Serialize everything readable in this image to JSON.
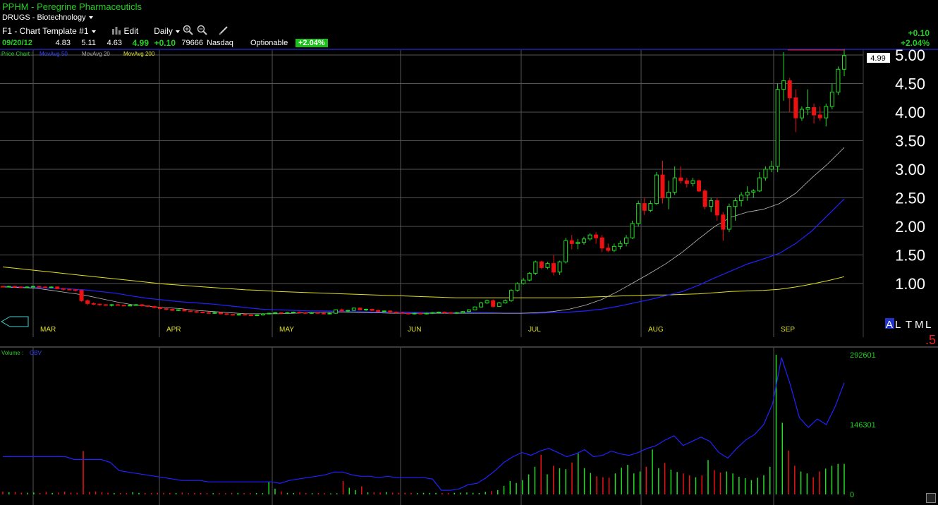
{
  "header": {
    "title": "PPHM - Peregrine Pharmaceuticls",
    "sector": "DRUGS - Biotechnology",
    "template": "F1 - Chart Template #1",
    "edit_label": "Edit",
    "period": "Daily",
    "icons": [
      "bar-chart-icon",
      "zoom-in-icon",
      "zoom-out-icon",
      "draw-pen-icon"
    ]
  },
  "quote": {
    "date": "09/20/12",
    "open": "4.83",
    "high": "5.11",
    "low": "4.63",
    "last": "4.99",
    "change": "+0.10",
    "volume": "79666",
    "exchange": "Nasdaq",
    "optionable": "Optionable",
    "change_pct": "+2.04%"
  },
  "top_change": {
    "value": "+0.10",
    "pct": "+2.04%"
  },
  "price_legend": {
    "label": "Price Chart :",
    "ma50": "MovAvg 50",
    "ma20": "MovAvg 20",
    "ma200": "MovAvg 200"
  },
  "volume_legend": {
    "label": "Volume :",
    "obv": "OBV"
  },
  "current_price_label": "4.99",
  "range_buttons": {
    "a": "A",
    "l": "L",
    "t": "T",
    "m": "M",
    "l2": "L"
  },
  "scale_note": ".5",
  "colors": {
    "up": "#22dd22",
    "down": "#ee1111",
    "ma20": "#cccccc",
    "ma50": "#2222ff",
    "ma200": "#e0e020",
    "obv": "#2222ff",
    "grid": "#555555"
  },
  "chart_data": [
    {
      "type": "candlestick",
      "y_ticks": [
        "5.00",
        "4.50",
        "4.00",
        "3.50",
        "3.00",
        "2.50",
        "2.00",
        "1.50",
        "1.00"
      ],
      "months": [
        "MAR",
        "APR",
        "MAY",
        "JUN",
        "JUL",
        "AUG",
        "SEP"
      ],
      "ylim": [
        0.2,
        5.05
      ],
      "candles": [
        [
          0.95,
          0.96,
          0.93,
          0.94
        ],
        [
          0.94,
          0.96,
          0.93,
          0.95
        ],
        [
          0.95,
          0.96,
          0.93,
          0.94
        ],
        [
          0.94,
          0.95,
          0.92,
          0.93
        ],
        [
          0.93,
          0.95,
          0.92,
          0.94
        ],
        [
          0.94,
          0.96,
          0.93,
          0.95
        ],
        [
          0.95,
          0.96,
          0.93,
          0.94
        ],
        [
          0.94,
          0.95,
          0.92,
          0.93
        ],
        [
          0.93,
          0.95,
          0.92,
          0.94
        ],
        [
          0.94,
          0.95,
          0.9,
          0.91
        ],
        [
          0.91,
          0.92,
          0.88,
          0.9
        ],
        [
          0.9,
          0.91,
          0.88,
          0.89
        ],
        [
          0.89,
          0.9,
          0.86,
          0.88
        ],
        [
          0.88,
          0.89,
          0.68,
          0.7
        ],
        [
          0.7,
          0.72,
          0.62,
          0.65
        ],
        [
          0.65,
          0.67,
          0.62,
          0.64
        ],
        [
          0.64,
          0.65,
          0.61,
          0.63
        ],
        [
          0.63,
          0.64,
          0.61,
          0.62
        ],
        [
          0.62,
          0.64,
          0.6,
          0.63
        ],
        [
          0.63,
          0.64,
          0.61,
          0.62
        ],
        [
          0.62,
          0.63,
          0.6,
          0.61
        ],
        [
          0.61,
          0.63,
          0.6,
          0.62
        ],
        [
          0.62,
          0.64,
          0.61,
          0.63
        ],
        [
          0.63,
          0.64,
          0.6,
          0.61
        ],
        [
          0.61,
          0.62,
          0.59,
          0.6
        ],
        [
          0.6,
          0.61,
          0.57,
          0.58
        ],
        [
          0.58,
          0.59,
          0.55,
          0.56
        ],
        [
          0.56,
          0.57,
          0.53,
          0.55
        ],
        [
          0.55,
          0.56,
          0.52,
          0.53
        ],
        [
          0.53,
          0.55,
          0.52,
          0.54
        ],
        [
          0.54,
          0.55,
          0.51,
          0.52
        ],
        [
          0.52,
          0.53,
          0.5,
          0.51
        ],
        [
          0.51,
          0.52,
          0.49,
          0.5
        ],
        [
          0.5,
          0.51,
          0.48,
          0.49
        ],
        [
          0.49,
          0.5,
          0.47,
          0.48
        ],
        [
          0.48,
          0.5,
          0.47,
          0.49
        ],
        [
          0.49,
          0.5,
          0.46,
          0.47
        ],
        [
          0.47,
          0.48,
          0.45,
          0.46
        ],
        [
          0.46,
          0.47,
          0.44,
          0.45
        ],
        [
          0.45,
          0.47,
          0.44,
          0.46
        ],
        [
          0.46,
          0.47,
          0.44,
          0.45
        ],
        [
          0.45,
          0.46,
          0.43,
          0.44
        ],
        [
          0.44,
          0.46,
          0.43,
          0.45
        ],
        [
          0.45,
          0.48,
          0.44,
          0.47
        ],
        [
          0.47,
          0.49,
          0.46,
          0.48
        ],
        [
          0.48,
          0.5,
          0.47,
          0.49
        ],
        [
          0.49,
          0.5,
          0.47,
          0.48
        ],
        [
          0.48,
          0.5,
          0.47,
          0.49
        ],
        [
          0.49,
          0.51,
          0.48,
          0.5
        ],
        [
          0.5,
          0.51,
          0.48,
          0.49
        ],
        [
          0.49,
          0.5,
          0.47,
          0.48
        ],
        [
          0.48,
          0.5,
          0.47,
          0.49
        ],
        [
          0.49,
          0.5,
          0.47,
          0.48
        ],
        [
          0.48,
          0.49,
          0.46,
          0.47
        ],
        [
          0.47,
          0.49,
          0.46,
          0.48
        ],
        [
          0.48,
          0.55,
          0.47,
          0.54
        ],
        [
          0.54,
          0.56,
          0.51,
          0.52
        ],
        [
          0.52,
          0.54,
          0.5,
          0.53
        ],
        [
          0.53,
          0.58,
          0.52,
          0.57
        ],
        [
          0.57,
          0.58,
          0.53,
          0.54
        ],
        [
          0.54,
          0.56,
          0.52,
          0.55
        ],
        [
          0.55,
          0.56,
          0.52,
          0.53
        ],
        [
          0.53,
          0.54,
          0.5,
          0.51
        ],
        [
          0.51,
          0.53,
          0.5,
          0.52
        ],
        [
          0.52,
          0.53,
          0.49,
          0.5
        ],
        [
          0.5,
          0.51,
          0.48,
          0.49
        ],
        [
          0.49,
          0.5,
          0.47,
          0.48
        ],
        [
          0.48,
          0.49,
          0.46,
          0.47
        ],
        [
          0.47,
          0.49,
          0.46,
          0.48
        ],
        [
          0.48,
          0.49,
          0.46,
          0.47
        ],
        [
          0.47,
          0.49,
          0.46,
          0.48
        ],
        [
          0.48,
          0.5,
          0.47,
          0.49
        ],
        [
          0.49,
          0.51,
          0.48,
          0.5
        ],
        [
          0.5,
          0.51,
          0.48,
          0.49
        ],
        [
          0.49,
          0.5,
          0.47,
          0.48
        ],
        [
          0.48,
          0.5,
          0.47,
          0.49
        ],
        [
          0.49,
          0.52,
          0.48,
          0.51
        ],
        [
          0.51,
          0.55,
          0.5,
          0.54
        ],
        [
          0.54,
          0.6,
          0.53,
          0.59
        ],
        [
          0.59,
          0.68,
          0.58,
          0.66
        ],
        [
          0.66,
          0.72,
          0.64,
          0.7
        ],
        [
          0.7,
          0.72,
          0.58,
          0.6
        ],
        [
          0.6,
          0.68,
          0.59,
          0.66
        ],
        [
          0.66,
          0.72,
          0.65,
          0.7
        ],
        [
          0.7,
          0.9,
          0.68,
          0.88
        ],
        [
          0.88,
          1.02,
          0.86,
          1.0
        ],
        [
          1.0,
          1.1,
          0.98,
          1.06
        ],
        [
          1.06,
          1.2,
          1.04,
          1.18
        ],
        [
          1.18,
          1.4,
          1.15,
          1.38
        ],
        [
          1.38,
          1.4,
          1.25,
          1.28
        ],
        [
          1.28,
          1.38,
          1.25,
          1.35
        ],
        [
          1.35,
          1.5,
          1.14,
          1.2
        ],
        [
          1.2,
          1.4,
          1.15,
          1.38
        ],
        [
          1.38,
          1.8,
          1.35,
          1.75
        ],
        [
          1.75,
          1.85,
          1.6,
          1.7
        ],
        [
          1.7,
          1.78,
          1.6,
          1.72
        ],
        [
          1.72,
          1.82,
          1.68,
          1.78
        ],
        [
          1.78,
          1.88,
          1.75,
          1.85
        ],
        [
          1.85,
          1.9,
          1.7,
          1.8
        ],
        [
          1.8,
          1.85,
          1.55,
          1.62
        ],
        [
          1.62,
          1.7,
          1.55,
          1.58
        ],
        [
          1.58,
          1.7,
          1.55,
          1.65
        ],
        [
          1.65,
          1.75,
          1.6,
          1.7
        ],
        [
          1.7,
          1.85,
          1.65,
          1.8
        ],
        [
          1.8,
          2.1,
          1.78,
          2.05
        ],
        [
          2.05,
          2.45,
          2.0,
          2.4
        ],
        [
          2.4,
          2.5,
          2.2,
          2.28
        ],
        [
          2.28,
          2.45,
          2.25,
          2.4
        ],
        [
          2.4,
          2.95,
          2.38,
          2.9
        ],
        [
          2.9,
          3.15,
          2.4,
          2.5
        ],
        [
          2.5,
          2.8,
          2.3,
          2.6
        ],
        [
          2.6,
          3.05,
          2.55,
          2.85
        ],
        [
          2.85,
          3.05,
          2.75,
          2.8
        ],
        [
          2.8,
          2.85,
          2.68,
          2.75
        ],
        [
          2.75,
          2.85,
          2.7,
          2.8
        ],
        [
          2.8,
          2.82,
          2.6,
          2.62
        ],
        [
          2.62,
          2.65,
          2.3,
          2.35
        ],
        [
          2.35,
          2.5,
          2.25,
          2.45
        ],
        [
          2.45,
          2.5,
          2.1,
          2.2
        ],
        [
          2.2,
          2.25,
          1.75,
          1.95
        ],
        [
          1.95,
          2.4,
          1.9,
          2.35
        ],
        [
          2.35,
          2.5,
          2.1,
          2.45
        ],
        [
          2.45,
          2.6,
          2.35,
          2.55
        ],
        [
          2.55,
          2.7,
          2.45,
          2.6
        ],
        [
          2.6,
          2.65,
          2.5,
          2.62
        ],
        [
          2.62,
          2.95,
          2.6,
          2.85
        ],
        [
          2.85,
          3.05,
          2.8,
          3.0
        ],
        [
          3.0,
          3.15,
          2.95,
          3.05
        ],
        [
          3.05,
          4.5,
          2.95,
          4.4
        ],
        [
          4.4,
          5.05,
          4.2,
          4.55
        ],
        [
          4.55,
          4.6,
          4.0,
          4.25
        ],
        [
          4.25,
          4.4,
          3.65,
          3.9
        ],
        [
          3.9,
          4.1,
          3.85,
          4.05
        ],
        [
          4.05,
          4.4,
          3.95,
          4.08
        ],
        [
          4.08,
          4.15,
          3.8,
          3.95
        ],
        [
          3.95,
          4.1,
          3.85,
          3.9
        ],
        [
          3.9,
          4.15,
          3.75,
          4.1
        ],
        [
          4.1,
          4.5,
          4.05,
          4.35
        ],
        [
          4.35,
          4.8,
          4.3,
          4.75
        ],
        [
          4.75,
          5.11,
          4.63,
          4.99
        ]
      ],
      "ma20": [
        0.94,
        0.93,
        0.92,
        0.88,
        0.84,
        0.8,
        0.74,
        0.68,
        0.63,
        0.6,
        0.58,
        0.56,
        0.53,
        0.51,
        0.49,
        0.47,
        0.47,
        0.47,
        0.48,
        0.49,
        0.5,
        0.5,
        0.49,
        0.49,
        0.48,
        0.48,
        0.48,
        0.48,
        0.48,
        0.48,
        0.48,
        0.48,
        0.48,
        0.49,
        0.51,
        0.55,
        0.62,
        0.72,
        0.86,
        1.02,
        1.18,
        1.35,
        1.55,
        1.78,
        2.0,
        2.16,
        2.25,
        2.3,
        2.4,
        2.58,
        2.85,
        3.1,
        3.38
      ],
      "ma50": [
        0.95,
        0.94,
        0.93,
        0.92,
        0.91,
        0.89,
        0.86,
        0.83,
        0.78,
        0.74,
        0.71,
        0.68,
        0.66,
        0.64,
        0.61,
        0.58,
        0.55,
        0.54,
        0.53,
        0.52,
        0.52,
        0.51,
        0.51,
        0.5,
        0.5,
        0.5,
        0.49,
        0.49,
        0.49,
        0.49,
        0.49,
        0.48,
        0.48,
        0.48,
        0.49,
        0.5,
        0.52,
        0.55,
        0.6,
        0.66,
        0.72,
        0.79,
        0.86,
        0.97,
        1.1,
        1.22,
        1.34,
        1.43,
        1.53,
        1.7,
        1.92,
        2.2,
        2.48
      ],
      "ma200": [
        1.29,
        1.26,
        1.23,
        1.2,
        1.17,
        1.14,
        1.11,
        1.08,
        1.05,
        1.02,
        0.99,
        0.97,
        0.95,
        0.93,
        0.91,
        0.89,
        0.88,
        0.86,
        0.85,
        0.84,
        0.83,
        0.82,
        0.81,
        0.8,
        0.79,
        0.78,
        0.77,
        0.76,
        0.75,
        0.75,
        0.75,
        0.75,
        0.75,
        0.75,
        0.75,
        0.75,
        0.76,
        0.77,
        0.78,
        0.79,
        0.8,
        0.8,
        0.81,
        0.82,
        0.84,
        0.86,
        0.87,
        0.88,
        0.9,
        0.94,
        0.99,
        1.05,
        1.12
      ]
    },
    {
      "type": "bar",
      "series_name": "Volume",
      "y_ticks": [
        "292601",
        "146301",
        "0"
      ],
      "ylim": [
        0,
        292601
      ],
      "volume": [
        6000,
        4500,
        5200,
        3800,
        3500,
        4100,
        3000,
        5400,
        3200,
        4000,
        5800,
        3900,
        3600,
        91000,
        5000,
        6100,
        4300,
        3600,
        2900,
        3100,
        2600,
        4800,
        3400,
        2900,
        2800,
        3500,
        3300,
        3100,
        3000,
        3900,
        2400,
        3000,
        3200,
        2800,
        2700,
        2600,
        2500,
        3400,
        3200,
        2800,
        2600,
        2900,
        2700,
        27000,
        12000,
        6000,
        3400,
        3000,
        3900,
        2800,
        2600,
        2700,
        2500,
        2300,
        2400,
        28000,
        14000,
        9000,
        17000,
        4400,
        4300,
        3900,
        5000,
        3800,
        3500,
        3600,
        3400,
        2900,
        3500,
        3100,
        3300,
        2900,
        2800,
        3400,
        3600,
        3900,
        3500,
        3000,
        5200,
        7000,
        9000,
        18000,
        28000,
        24000,
        30000,
        42000,
        58000,
        83000,
        42000,
        60000,
        55000,
        53000,
        67000,
        86000,
        55000,
        45000,
        38000,
        36000,
        35000,
        44000,
        56000,
        62000,
        44000,
        48000,
        58000,
        94000,
        55000,
        66000,
        52000,
        47000,
        44000,
        40000,
        36000,
        40000,
        72000,
        51000,
        46000,
        48000,
        44000,
        37000,
        34000,
        30000,
        35000,
        40000,
        58000,
        292601,
        150000,
        92000,
        60000,
        48000,
        44000,
        36000,
        48000,
        54000,
        60000,
        64000,
        64000
      ],
      "obv_series_name": "OBV",
      "obv": [
        0.27,
        0.27,
        0.27,
        0.27,
        0.27,
        0.27,
        0.27,
        0.27,
        0.25,
        0.25,
        0.25,
        0.25,
        0.23,
        0.17,
        0.16,
        0.15,
        0.14,
        0.13,
        0.12,
        0.11,
        0.1,
        0.1,
        0.1,
        0.09,
        0.09,
        0.09,
        0.09,
        0.09,
        0.09,
        0.09,
        0.09,
        0.08,
        0.1,
        0.11,
        0.12,
        0.13,
        0.14,
        0.16,
        0.16,
        0.14,
        0.13,
        0.13,
        0.12,
        0.13,
        0.12,
        0.12,
        0.12,
        0.12,
        0.11,
        0.03,
        0.03,
        0.04,
        0.07,
        0.08,
        0.12,
        0.17,
        0.23,
        0.27,
        0.3,
        0.28,
        0.31,
        0.33,
        0.3,
        0.27,
        0.29,
        0.32,
        0.27,
        0.28,
        0.31,
        0.29,
        0.28,
        0.3,
        0.33,
        0.35,
        0.39,
        0.42,
        0.35,
        0.38,
        0.41,
        0.38,
        0.3,
        0.26,
        0.33,
        0.39,
        0.43,
        0.5,
        0.65,
        0.98,
        0.78,
        0.55,
        0.48,
        0.54,
        0.5,
        0.63,
        0.8
      ]
    }
  ]
}
